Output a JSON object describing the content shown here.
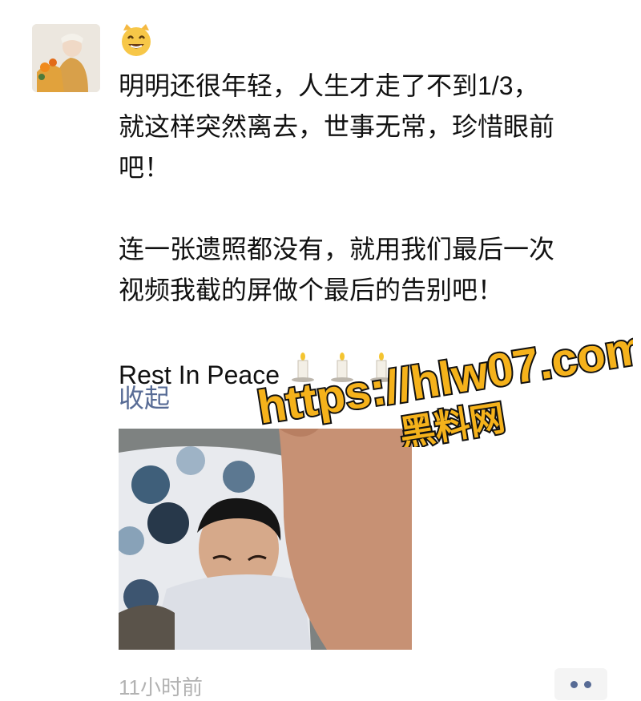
{
  "post": {
    "emoji": "😸",
    "lines": [
      "明明还很年轻，人生才走了不到1/3，",
      "就这样突然离去，世事无常，珍惜眼前",
      "吧！",
      "连一张遗照都没有，就用我们最后一次",
      "视频我截的屏做个最后的告别吧！"
    ],
    "rip_text": "Rest In Peace",
    "candle_icons": [
      "candle-icon",
      "candle-icon",
      "candle-icon"
    ],
    "collapse_label": "收起",
    "timestamp": "11小时前"
  },
  "watermark": {
    "url": "https://hlw07.com",
    "label": "黑料网"
  },
  "colors": {
    "link": "#576b95",
    "text": "#111111",
    "timestamp": "#b2b2b2",
    "watermark_fill": "#f5b21b",
    "watermark_stroke": "#111111"
  }
}
